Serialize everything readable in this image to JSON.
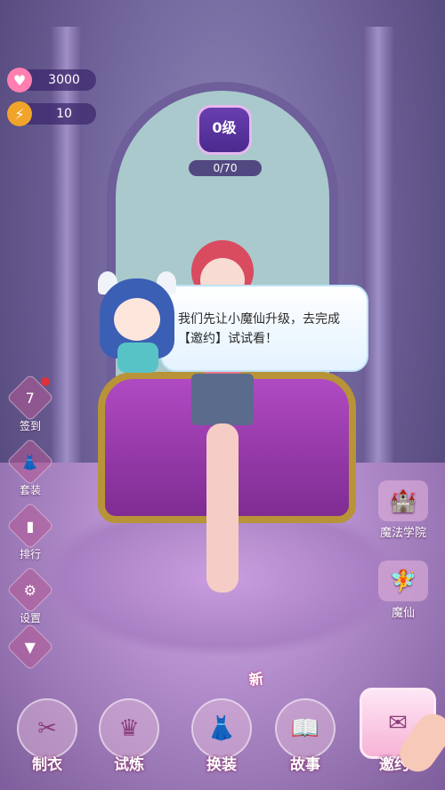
{
  "resources": {
    "gems": {
      "icon": "heart-gem-icon",
      "value": "3000"
    },
    "energy": {
      "icon": "lightning-icon",
      "value": "10"
    }
  },
  "level": {
    "label": "0级",
    "progress": "0/70"
  },
  "dialog": {
    "text": "我们先让小魔仙升级，去完成【邀约】试试看！"
  },
  "left_menu": [
    {
      "label": "签到",
      "icon": "calendar-icon",
      "badge": true
    },
    {
      "label": "套装",
      "icon": "dress-icon"
    },
    {
      "label": "排行",
      "icon": "rank-icon"
    },
    {
      "label": "设置",
      "icon": "gear-icon"
    }
  ],
  "right_menu": [
    {
      "label": "魔法学院",
      "icon": "castle-icon"
    },
    {
      "label": "魔仙",
      "icon": "fairy-icon"
    }
  ],
  "bottom_nav": [
    {
      "label": "制衣",
      "icon": "sewing-machine-icon"
    },
    {
      "label": "试炼",
      "icon": "crown-icon"
    },
    {
      "label": "换装",
      "icon": "gown-icon"
    },
    {
      "label": "故事",
      "icon": "book-icon"
    },
    {
      "label": "邀约",
      "icon": "envelope-icon",
      "active": true
    }
  ],
  "new_tag": "新"
}
